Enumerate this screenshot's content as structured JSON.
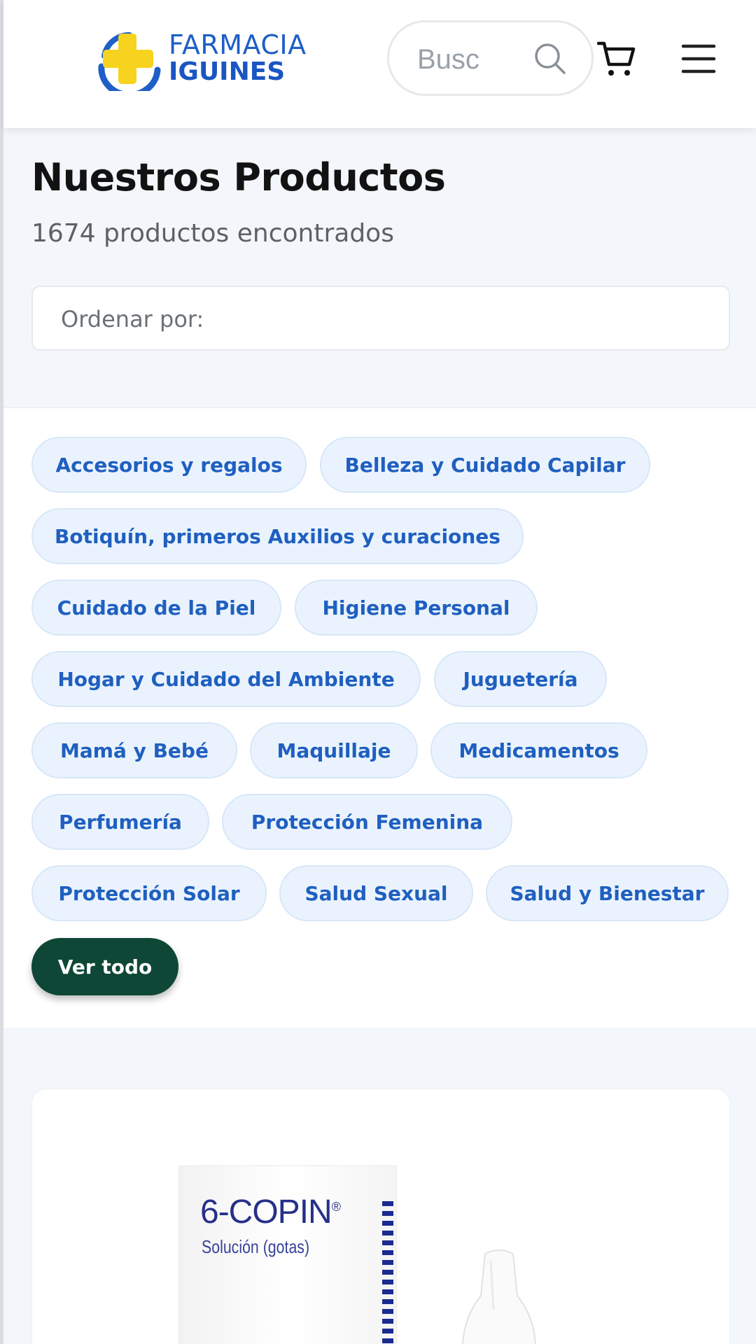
{
  "header": {
    "logo": {
      "line1": "FARMACIA",
      "line2": "IGUINES"
    },
    "search": {
      "placeholder": "Busc",
      "icon": "search-icon"
    },
    "cart_icon": "cart-icon",
    "menu_icon": "menu-icon"
  },
  "main": {
    "title": "Nuestros Productos",
    "result_count": "1674 productos encontrados",
    "sort_label": "Ordenar por:"
  },
  "categories": [
    "Accesorios y regalos",
    "Belleza y Cuidado Capilar",
    "Botiquín, primeros Auxilios y curaciones",
    "Cuidado de la Piel",
    "Higiene Personal",
    "Hogar y Cuidado del Ambiente",
    "Juguetería",
    "Mamá y Bebé",
    "Maquillaje",
    "Medicamentos",
    "Perfumería",
    "Protección Femenina",
    "Protección Solar",
    "Salud Sexual",
    "Salud y Bienestar"
  ],
  "view_all_label": "Ver todo",
  "product": {
    "brand": "6-COPIN",
    "registered": "®",
    "subtitle": "Solución (gotas)"
  },
  "colors": {
    "brand_blue": "#1e5fc8",
    "chip_bg": "#eaf3fd",
    "view_all_bg": "#0f4736",
    "logo_yellow": "#f7d21e"
  }
}
